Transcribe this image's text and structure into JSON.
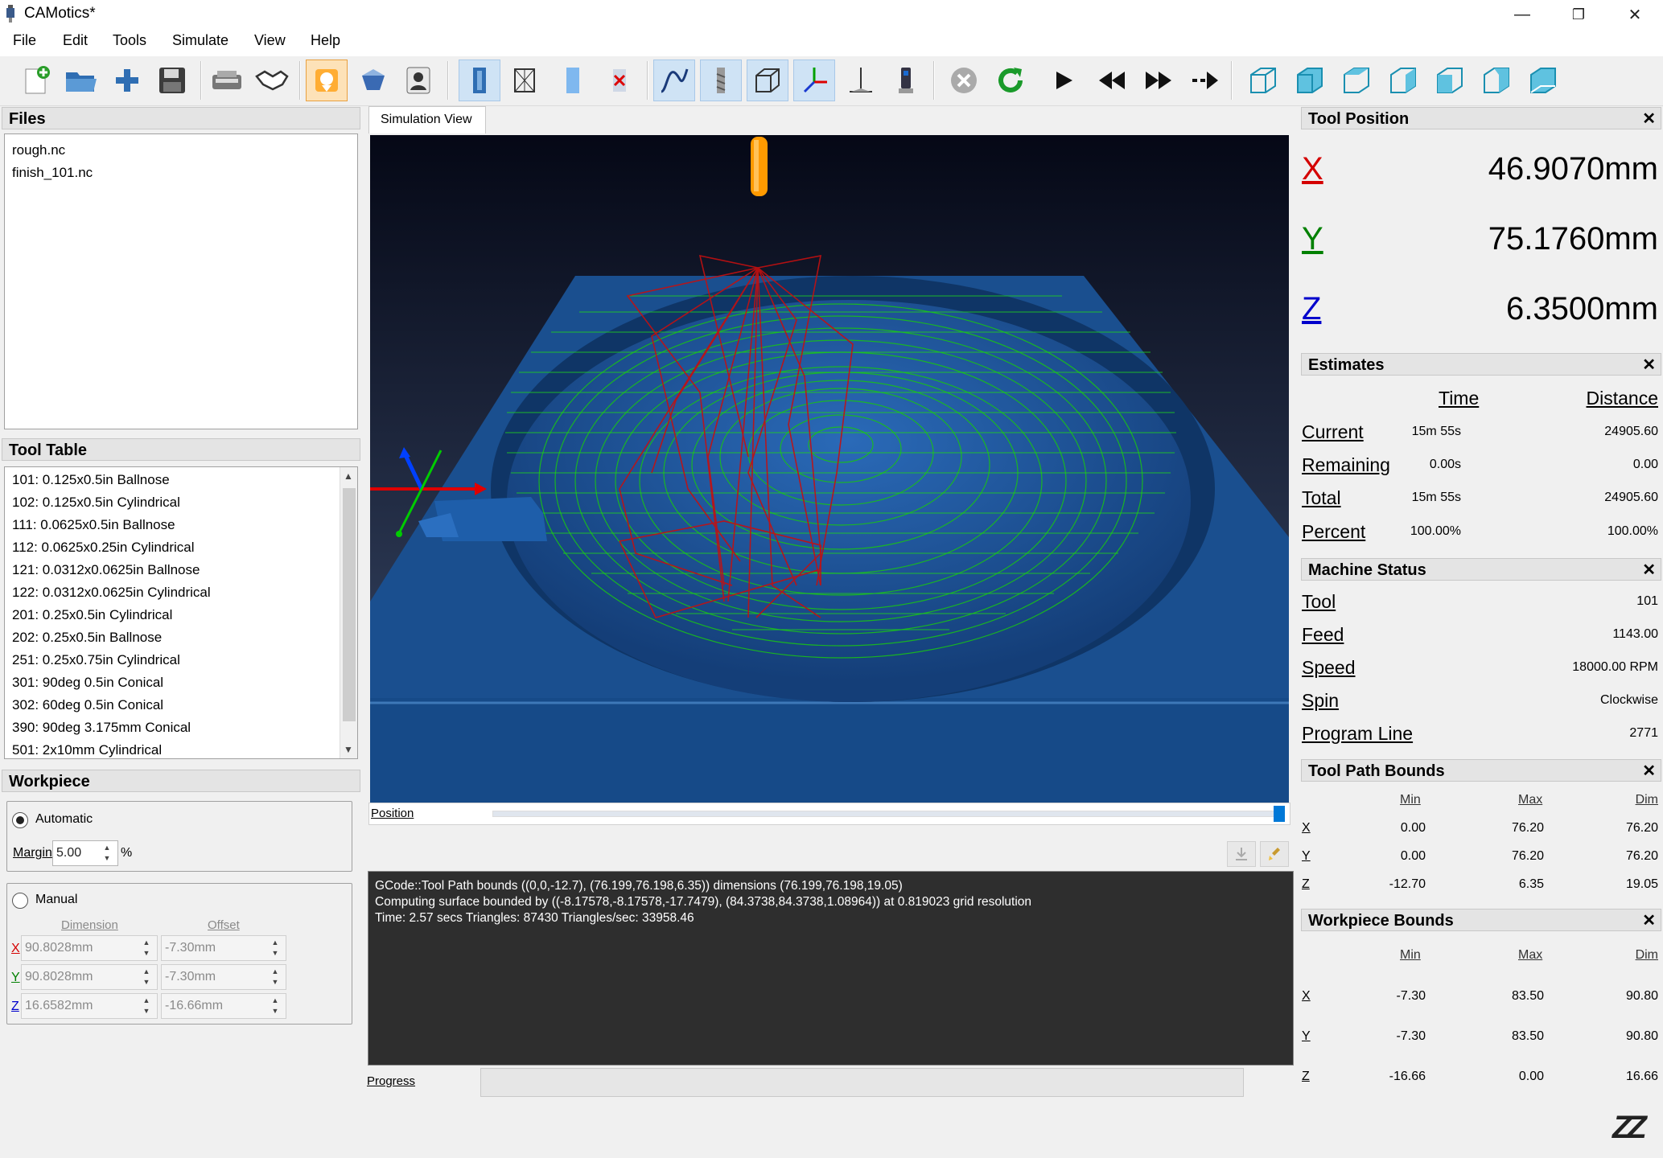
{
  "window": {
    "title": "CAMotics*",
    "minimize": "—",
    "maximize": "❐",
    "close": "✕"
  },
  "menu": [
    "File",
    "Edit",
    "Tools",
    "Simulate",
    "View",
    "Help"
  ],
  "toolbar": {
    "icons": [
      "new-file-icon",
      "open-file-icon",
      "add-file-icon",
      "save-icon",
      "settings-icon",
      "handshake-icon",
      "camotics-icon",
      "export-icon",
      "user-icon",
      "surface-view-icon",
      "wireframe-view-icon",
      "solid-view-icon",
      "hide-surface-icon",
      "toolpath-icon",
      "tool-icon",
      "bounding-box-icon",
      "axes-icon",
      "origin-icon",
      "machine-icon",
      "stop-icon",
      "rerun-icon",
      "play-icon",
      "slower-icon",
      "faster-icon",
      "step-icon",
      "iso-view-icon",
      "front-view-icon",
      "back-view-icon",
      "left-view-icon",
      "right-view-icon",
      "top-view-icon",
      "bottom-view-icon"
    ]
  },
  "files": {
    "title": "Files",
    "items": [
      "rough.nc",
      "finish_101.nc"
    ]
  },
  "tool_table": {
    "title": "Tool Table",
    "items": [
      "101: 0.125x0.5in Ballnose",
      "102: 0.125x0.5in Cylindrical",
      "111: 0.0625x0.5in Ballnose",
      "112: 0.0625x0.25in Cylindrical",
      "121: 0.0312x0.0625in Ballnose",
      "122: 0.0312x0.0625in Cylindrical",
      "201: 0.25x0.5in Cylindrical",
      "202: 0.25x0.5in Ballnose",
      "251: 0.25x0.75in Cylindrical",
      "301: 90deg 0.5in Conical",
      "302: 60deg 0.5in Conical",
      "390: 90deg 3.175mm Conical",
      "501: 2x10mm Cylindrical"
    ]
  },
  "workpiece": {
    "title": "Workpiece",
    "automatic_label": "Automatic",
    "margin_label": "Margin",
    "margin_value": "5.00",
    "percent": "%",
    "manual_label": "Manual",
    "dimension_header": "Dimension",
    "offset_header": "Offset",
    "rows": [
      {
        "axis": "X",
        "dimension": "90.8028mm",
        "offset": "-7.30mm"
      },
      {
        "axis": "Y",
        "dimension": "90.8028mm",
        "offset": "-7.30mm"
      },
      {
        "axis": "Z",
        "dimension": "16.6582mm",
        "offset": "-16.66mm"
      }
    ]
  },
  "simulation": {
    "tab_label": "Simulation View",
    "position_label": "Position",
    "position_fraction": 1.0
  },
  "console": {
    "lines": [
      "GCode::Tool Path bounds ((0,0,-12.7), (76.199,76.198,6.35)) dimensions (76.199,76.198,19.05)",
      "Computing surface bounded by ((-8.17578,-8.17578,-17.7479), (84.3738,84.3738,1.08964)) at 0.819023 grid resolution",
      "Time: 2.57 secs Triangles: 87430 Triangles/sec: 33958.46"
    ],
    "progress_label": "Progress"
  },
  "tool_position": {
    "title": "Tool Position",
    "x_label": "X",
    "x_value": "46.9070mm",
    "y_label": "Y",
    "y_value": "75.1760mm",
    "z_label": "Z",
    "z_value": "6.3500mm"
  },
  "estimates": {
    "title": "Estimates",
    "time_header": "Time",
    "distance_header": "Distance",
    "rows": [
      {
        "label": "Current",
        "time": "15m 55s",
        "distance": "24905.60"
      },
      {
        "label": "Remaining",
        "time": "0.00s",
        "distance": "0.00"
      },
      {
        "label": "Total",
        "time": "15m 55s",
        "distance": "24905.60"
      },
      {
        "label": "Percent",
        "time": "100.00%",
        "distance": "100.00%"
      }
    ]
  },
  "machine_status": {
    "title": "Machine Status",
    "rows": [
      {
        "label": "Tool",
        "value": "101"
      },
      {
        "label": "Feed",
        "value": "1143.00"
      },
      {
        "label": "Speed",
        "value": "18000.00 RPM"
      },
      {
        "label": "Spin",
        "value": "Clockwise"
      },
      {
        "label": "Program Line",
        "value": "2771"
      }
    ]
  },
  "tool_path_bounds": {
    "title": "Tool Path Bounds",
    "min_header": "Min",
    "max_header": "Max",
    "dim_header": "Dim",
    "rows": [
      {
        "axis": "X",
        "min": "0.00",
        "max": "76.20",
        "dim": "76.20"
      },
      {
        "axis": "Y",
        "min": "0.00",
        "max": "76.20",
        "dim": "76.20"
      },
      {
        "axis": "Z",
        "min": "-12.70",
        "max": "6.35",
        "dim": "19.05"
      }
    ]
  },
  "workpiece_bounds": {
    "title": "Workpiece Bounds",
    "min_header": "Min",
    "max_header": "Max",
    "dim_header": "Dim",
    "rows": [
      {
        "axis": "X",
        "min": "-7.30",
        "max": "83.50",
        "dim": "90.80"
      },
      {
        "axis": "Y",
        "min": "-7.30",
        "max": "83.50",
        "dim": "90.80"
      },
      {
        "axis": "Z",
        "min": "-16.66",
        "max": "0.00",
        "dim": "16.66"
      }
    ]
  },
  "colors": {
    "x_axis": "#d40000",
    "y_axis": "#008000",
    "z_axis": "#0000cc",
    "accent": "#0078d7",
    "workpiece": "#1a4f8f",
    "toolpath": "#00c000",
    "rapid": "#c00000",
    "tool": "#ff9a00"
  },
  "status": {
    "sleep_icon": "ZZ"
  }
}
